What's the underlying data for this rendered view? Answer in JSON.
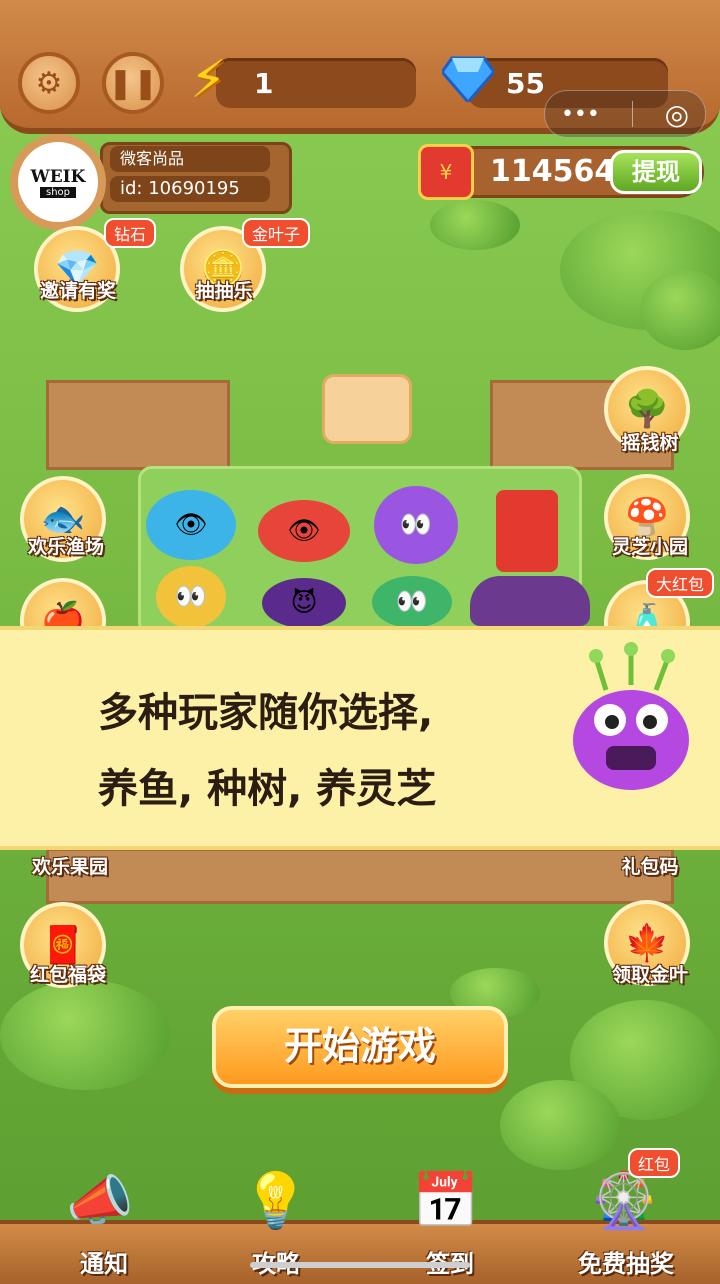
{
  "top": {
    "energy": "1",
    "gems": "55",
    "capsule_more": "•••",
    "capsule_target": "◎"
  },
  "profile": {
    "avatar_text_top": "WEIK",
    "avatar_text_bottom": "shop",
    "name": "微客尚品",
    "id": "id: 10690195"
  },
  "wallet": {
    "amount": "114564",
    "withdraw_label": "提现",
    "redpack_symbol": "¥"
  },
  "top_icons": [
    {
      "label": "邀请有奖",
      "tag": "钻石"
    },
    {
      "label": "抽抽乐",
      "tag": "金叶子"
    }
  ],
  "left_icons": [
    {
      "label": "欢乐渔场"
    },
    {
      "label": "欢乐果园"
    },
    {
      "label": "红包福袋"
    }
  ],
  "right_icons": [
    {
      "label": "摇钱树"
    },
    {
      "label": "灵芝小园"
    },
    {
      "label": "礼包码",
      "tag": "大红包"
    },
    {
      "label": "领取金叶"
    }
  ],
  "banner": {
    "line1": "多种玩家随你选择,",
    "line2": "养鱼, 种树, 养灵芝"
  },
  "start_label": "开始游戏",
  "bottom_nav": [
    {
      "label": "通知"
    },
    {
      "label": "攻略"
    },
    {
      "label": "签到"
    },
    {
      "label": "免费抽奖",
      "tag": "红包"
    }
  ],
  "colors": {
    "wood": "#b8692e",
    "grass": "#7cc24a",
    "banner": "#fdf1a8",
    "accent": "#ff9a1f"
  }
}
